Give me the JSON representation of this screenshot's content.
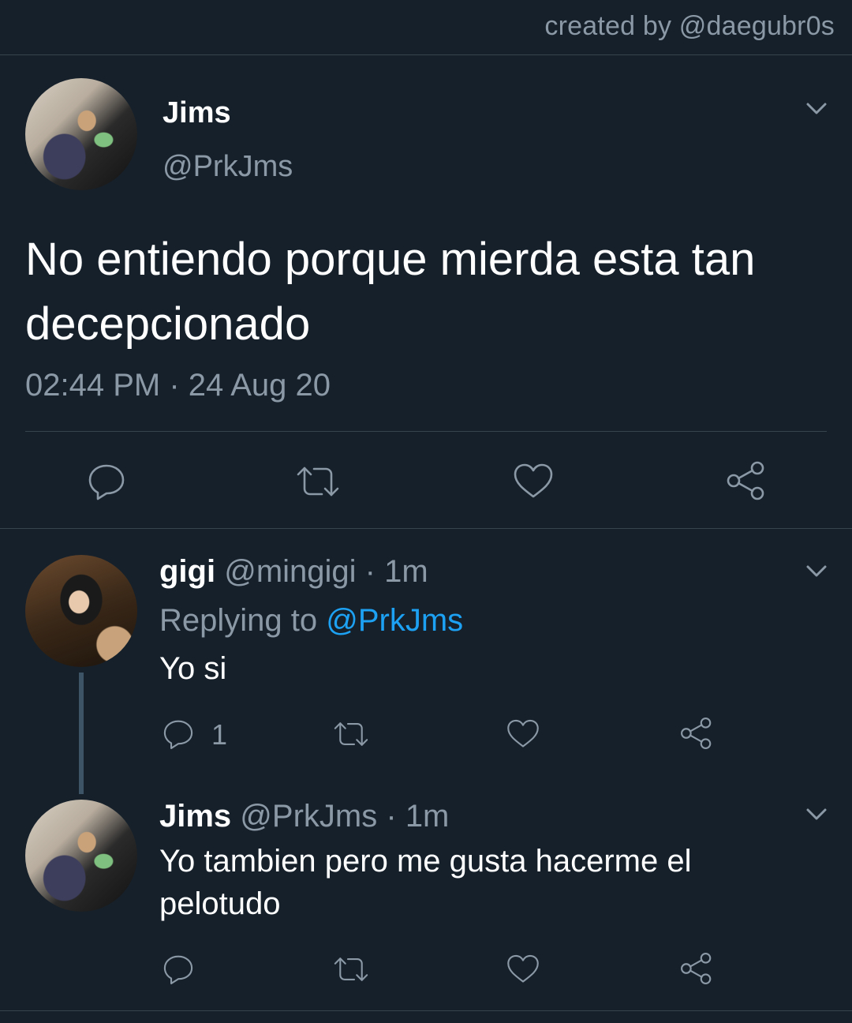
{
  "watermark": "created by @daegubr0s",
  "main_tweet": {
    "name": "Jims",
    "handle": "@PrkJms",
    "text": "No entiendo porque mierda esta tan decepcionado",
    "timestamp": "02:44 PM",
    "separator": "·",
    "date": "24 Aug 20",
    "avatar_icon": "profile-photo",
    "menu_icon": "chevron-down-icon",
    "actions": [
      "reply-icon",
      "retweet-icon",
      "like-icon",
      "share-icon"
    ]
  },
  "replies": [
    {
      "name": "gigi",
      "handle": "@mingigi",
      "separator": "·",
      "time": "1m",
      "replying_label": "Replying to",
      "replying_to": "@PrkJms",
      "text": "Yo si",
      "reply_count": "1",
      "avatar_icon": "profile-photo"
    },
    {
      "name": "Jims",
      "handle": "@PrkJms",
      "separator": "·",
      "time": "1m",
      "text": "Yo tambien pero me gusta hacerme el pelotudo",
      "avatar_icon": "profile-photo"
    }
  ],
  "colors": {
    "background": "#15202b",
    "text_primary": "#ffffff",
    "text_secondary": "#8b98a5",
    "accent": "#1da1f2",
    "divider": "#38444d"
  }
}
